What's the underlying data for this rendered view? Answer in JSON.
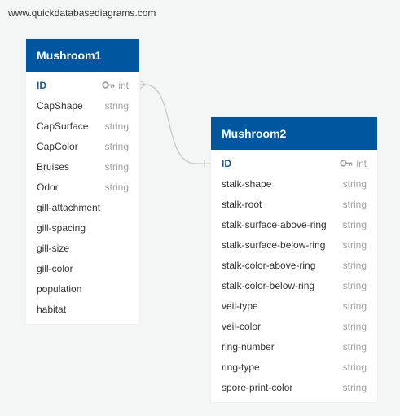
{
  "watermark": "www.quickdatabasediagrams.com",
  "colors": {
    "header": "#00569f",
    "pk": "#1a5aa0",
    "type": "#a0a0a0",
    "connector": "#c8c8c8",
    "background": "#f4f5f5"
  },
  "tables": [
    {
      "name": "Mushroom1",
      "columns": [
        {
          "name": "ID",
          "type": "int",
          "pk": true
        },
        {
          "name": "CapShape",
          "type": "string"
        },
        {
          "name": "CapSurface",
          "type": "string"
        },
        {
          "name": "CapColor",
          "type": "string"
        },
        {
          "name": "Bruises",
          "type": "string"
        },
        {
          "name": "Odor",
          "type": "string"
        },
        {
          "name": "gill-attachment",
          "type": ""
        },
        {
          "name": "gill-spacing",
          "type": ""
        },
        {
          "name": "gill-size",
          "type": ""
        },
        {
          "name": "gill-color",
          "type": ""
        },
        {
          "name": "population",
          "type": ""
        },
        {
          "name": "habitat",
          "type": ""
        }
      ]
    },
    {
      "name": "Mushroom2",
      "columns": [
        {
          "name": "ID",
          "type": "int",
          "pk": true
        },
        {
          "name": "stalk-shape",
          "type": "string"
        },
        {
          "name": "stalk-root",
          "type": "string"
        },
        {
          "name": "stalk-surface-above-ring",
          "type": "string"
        },
        {
          "name": "stalk-surface-below-ring",
          "type": "string"
        },
        {
          "name": "stalk-color-above-ring",
          "type": "string"
        },
        {
          "name": "stalk-color-below-ring",
          "type": "string"
        },
        {
          "name": "veil-type",
          "type": "string"
        },
        {
          "name": "veil-color",
          "type": "string"
        },
        {
          "name": "ring-number",
          "type": "string"
        },
        {
          "name": "ring-type",
          "type": "string"
        },
        {
          "name": "spore-print-color",
          "type": "string"
        }
      ]
    }
  ]
}
